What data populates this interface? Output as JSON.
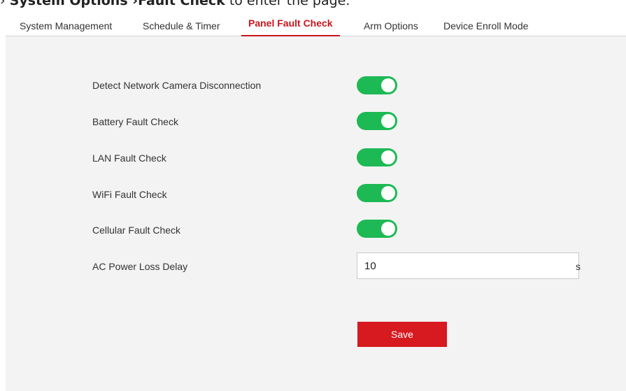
{
  "caption": {
    "prefix": "› ",
    "part1": "System Options",
    "arrow": " ›",
    "part2": "Fault Check",
    "suffix": " to enter the page."
  },
  "tabs": [
    {
      "label": "System Management",
      "active": false
    },
    {
      "label": "Schedule & Timer",
      "active": false
    },
    {
      "label": "Panel Fault Check",
      "active": true
    },
    {
      "label": "Arm Options",
      "active": false
    },
    {
      "label": "Device Enroll Mode",
      "active": false
    }
  ],
  "settings": [
    {
      "label": "Detect Network Camera Disconnection",
      "enabled": true
    },
    {
      "label": "Battery Fault Check",
      "enabled": true
    },
    {
      "label": "LAN Fault Check",
      "enabled": true
    },
    {
      "label": "WiFi Fault Check",
      "enabled": true
    },
    {
      "label": "Cellular Fault Check",
      "enabled": true
    }
  ],
  "ac_power": {
    "label": "AC Power Loss Delay",
    "value": "10",
    "unit": "s"
  },
  "save_label": "Save",
  "colors": {
    "accent": "#c8151d",
    "toggle_on": "#1db954",
    "button": "#d71920"
  }
}
